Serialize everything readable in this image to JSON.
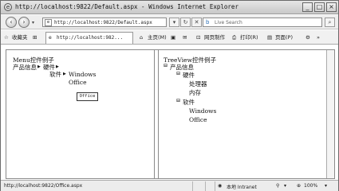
{
  "window": {
    "title": "http://localhost:9822/Default.aspx - Windows Internet Explorer",
    "controls": [
      "_",
      "□",
      "×"
    ]
  },
  "addressbar": {
    "url": "http://localhost:9822/Default.aspx",
    "search_placeholder": "Live Search"
  },
  "commandbar": {
    "favorites": "收藏夹",
    "tab_title": "http://localhost:982...",
    "home": "主页(M)",
    "page_tools": "网页制作",
    "print": "打印(R)",
    "page": "页面(P)"
  },
  "menu_panel": {
    "title": "Menu控件例子",
    "item_products": "产品信息",
    "item_hardware": "硬件",
    "item_software": "软件",
    "sub_windows": "Windows",
    "sub_office": "Office",
    "tooltip": "Office"
  },
  "tree_panel": {
    "title": "TreeView控件例子",
    "root": "产品信息",
    "hardware": "硬件",
    "processor": "处理器",
    "memory": "内存",
    "software": "软件",
    "windows": "Windows",
    "office": "Office"
  },
  "status": {
    "url": "http://localhost:9822/Office.aspx",
    "zone": "本地 Intranet",
    "zoom": "100%"
  },
  "colors": {
    "titlebar": "#d8d8d8",
    "border": "#8a8a8a"
  }
}
